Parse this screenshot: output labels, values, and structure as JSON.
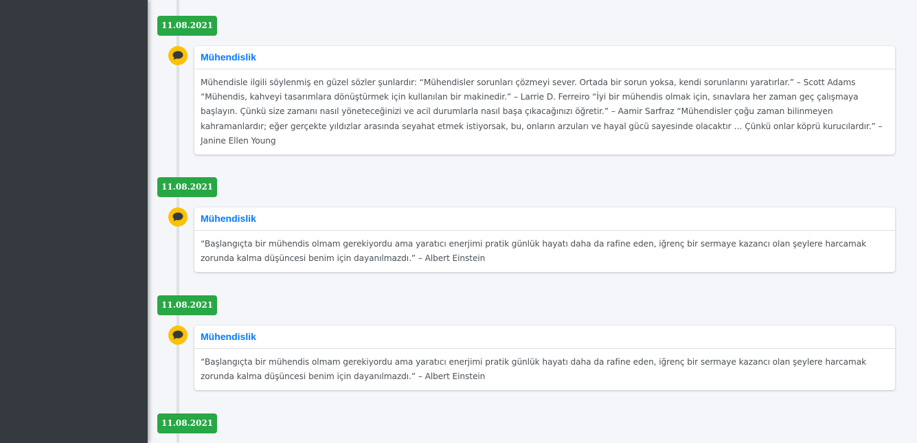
{
  "timeline": {
    "entries": [
      {
        "date": "11.08.2021",
        "title": "Mühendislik",
        "body": "Mühendisle ilgili söylenmiş en güzel sözler şunlardır: “Mühendisler sorunları çözmeyi sever. Ortada bir sorun yoksa, kendi sorunlarını yaratırlar.” – Scott Adams “Mühendis, kahveyi tasarımlara dönüştürmek için kullanılan bir makinedir.” – Larrie D. Ferreiro “İyi bir mühendis olmak için, sınavlara her zaman geç çalışmaya başlayın. Çünkü size zamanı nasıl yöneteceğinizi ve acil durumlarla nasıl başa çıkacağınızı öğretir.” – Aamir Sarfraz “Mühendisler çoğu zaman bilinmeyen kahramanlardır; eğer gerçekte yıldızlar arasında seyahat etmek istiyorsak, bu, onların arzuları ve hayal gücü sayesinde olacaktır … Çünkü onlar köprü kurucılardır.” – Janine Ellen Young",
        "icon": "comment-icon"
      },
      {
        "date": "11.08.2021",
        "title": "Mühendislik",
        "body": "“Başlangıçta bir mühendis olmam gerekiyordu ama yaratıcı enerjimi pratik günlük hayatı daha da rafine eden, iğrenç bir sermaye kazancı olan şeylere harcamak zorunda kalma düşüncesi benim için dayanılmazdı.” – Albert Einstein",
        "icon": "comment-icon"
      },
      {
        "date": "11.08.2021",
        "title": "Mühendislik",
        "body": "“Başlangıçta bir mühendis olmam gerekiyordu ama yaratıcı enerjimi pratik günlük hayatı daha da rafine eden, iğrenç bir sermaye kazancı olan şeylere harcamak zorunda kalma düşüncesi benim için dayanılmazdı.” – Albert Einstein",
        "icon": "comment-icon"
      },
      {
        "date": "11.08.2021"
      }
    ]
  },
  "colors": {
    "sidebar": "#343a40",
    "background": "#f4f6f9",
    "date_badge": "#28a745",
    "icon_bg": "#ffc107",
    "title_link": "#007bff",
    "body_text": "#495057"
  }
}
